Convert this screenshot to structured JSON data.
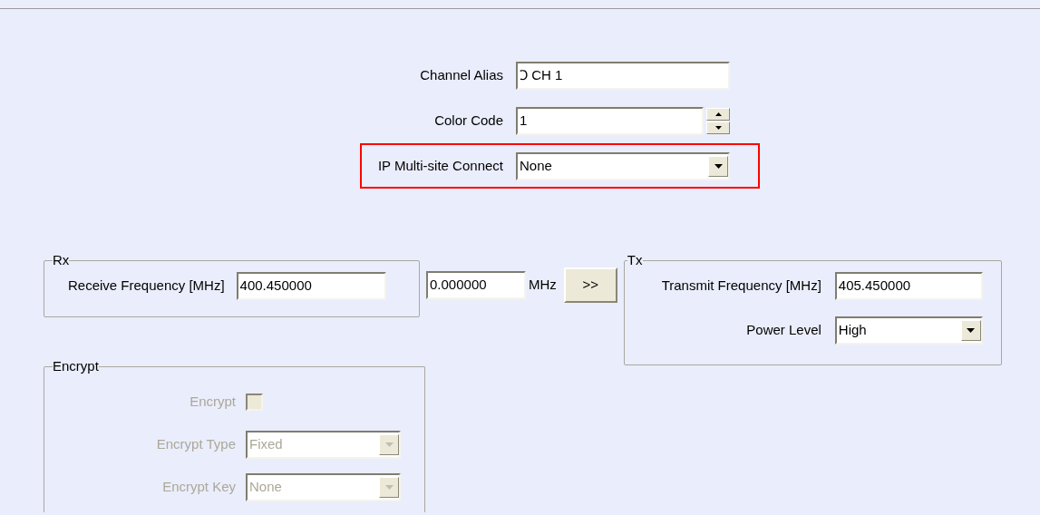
{
  "top_fields": [
    {
      "label": "Channel Alias",
      "kind": "text",
      "value": "Ↄ CH 1",
      "highlighted": false
    },
    {
      "label": "Color Code",
      "kind": "spinner",
      "value": "1",
      "highlighted": false
    },
    {
      "label": "IP Multi-site Connect",
      "kind": "dropdown",
      "value": "None",
      "highlighted": true
    }
  ],
  "rx": {
    "title": "Rx",
    "fields": [
      {
        "label": "Receive Frequency [MHz]",
        "kind": "text",
        "value": "400.450000"
      }
    ]
  },
  "offset": {
    "value": "0.000000",
    "unit": "MHz",
    "button": ">>"
  },
  "tx": {
    "title": "Tx",
    "fields": [
      {
        "label": "Transmit Frequency [MHz]",
        "kind": "text",
        "value": "405.450000"
      },
      {
        "label": "Power Level",
        "kind": "dropdown",
        "value": "High"
      }
    ]
  },
  "encrypt": {
    "title": "Encrypt",
    "disabled": true,
    "fields": [
      {
        "label": "Encrypt",
        "kind": "checkbox",
        "checked": false
      },
      {
        "label": "Encrypt Type",
        "kind": "dropdown",
        "value": "Fixed"
      },
      {
        "label": "Encrypt Key",
        "kind": "dropdown",
        "value": "None"
      }
    ]
  }
}
